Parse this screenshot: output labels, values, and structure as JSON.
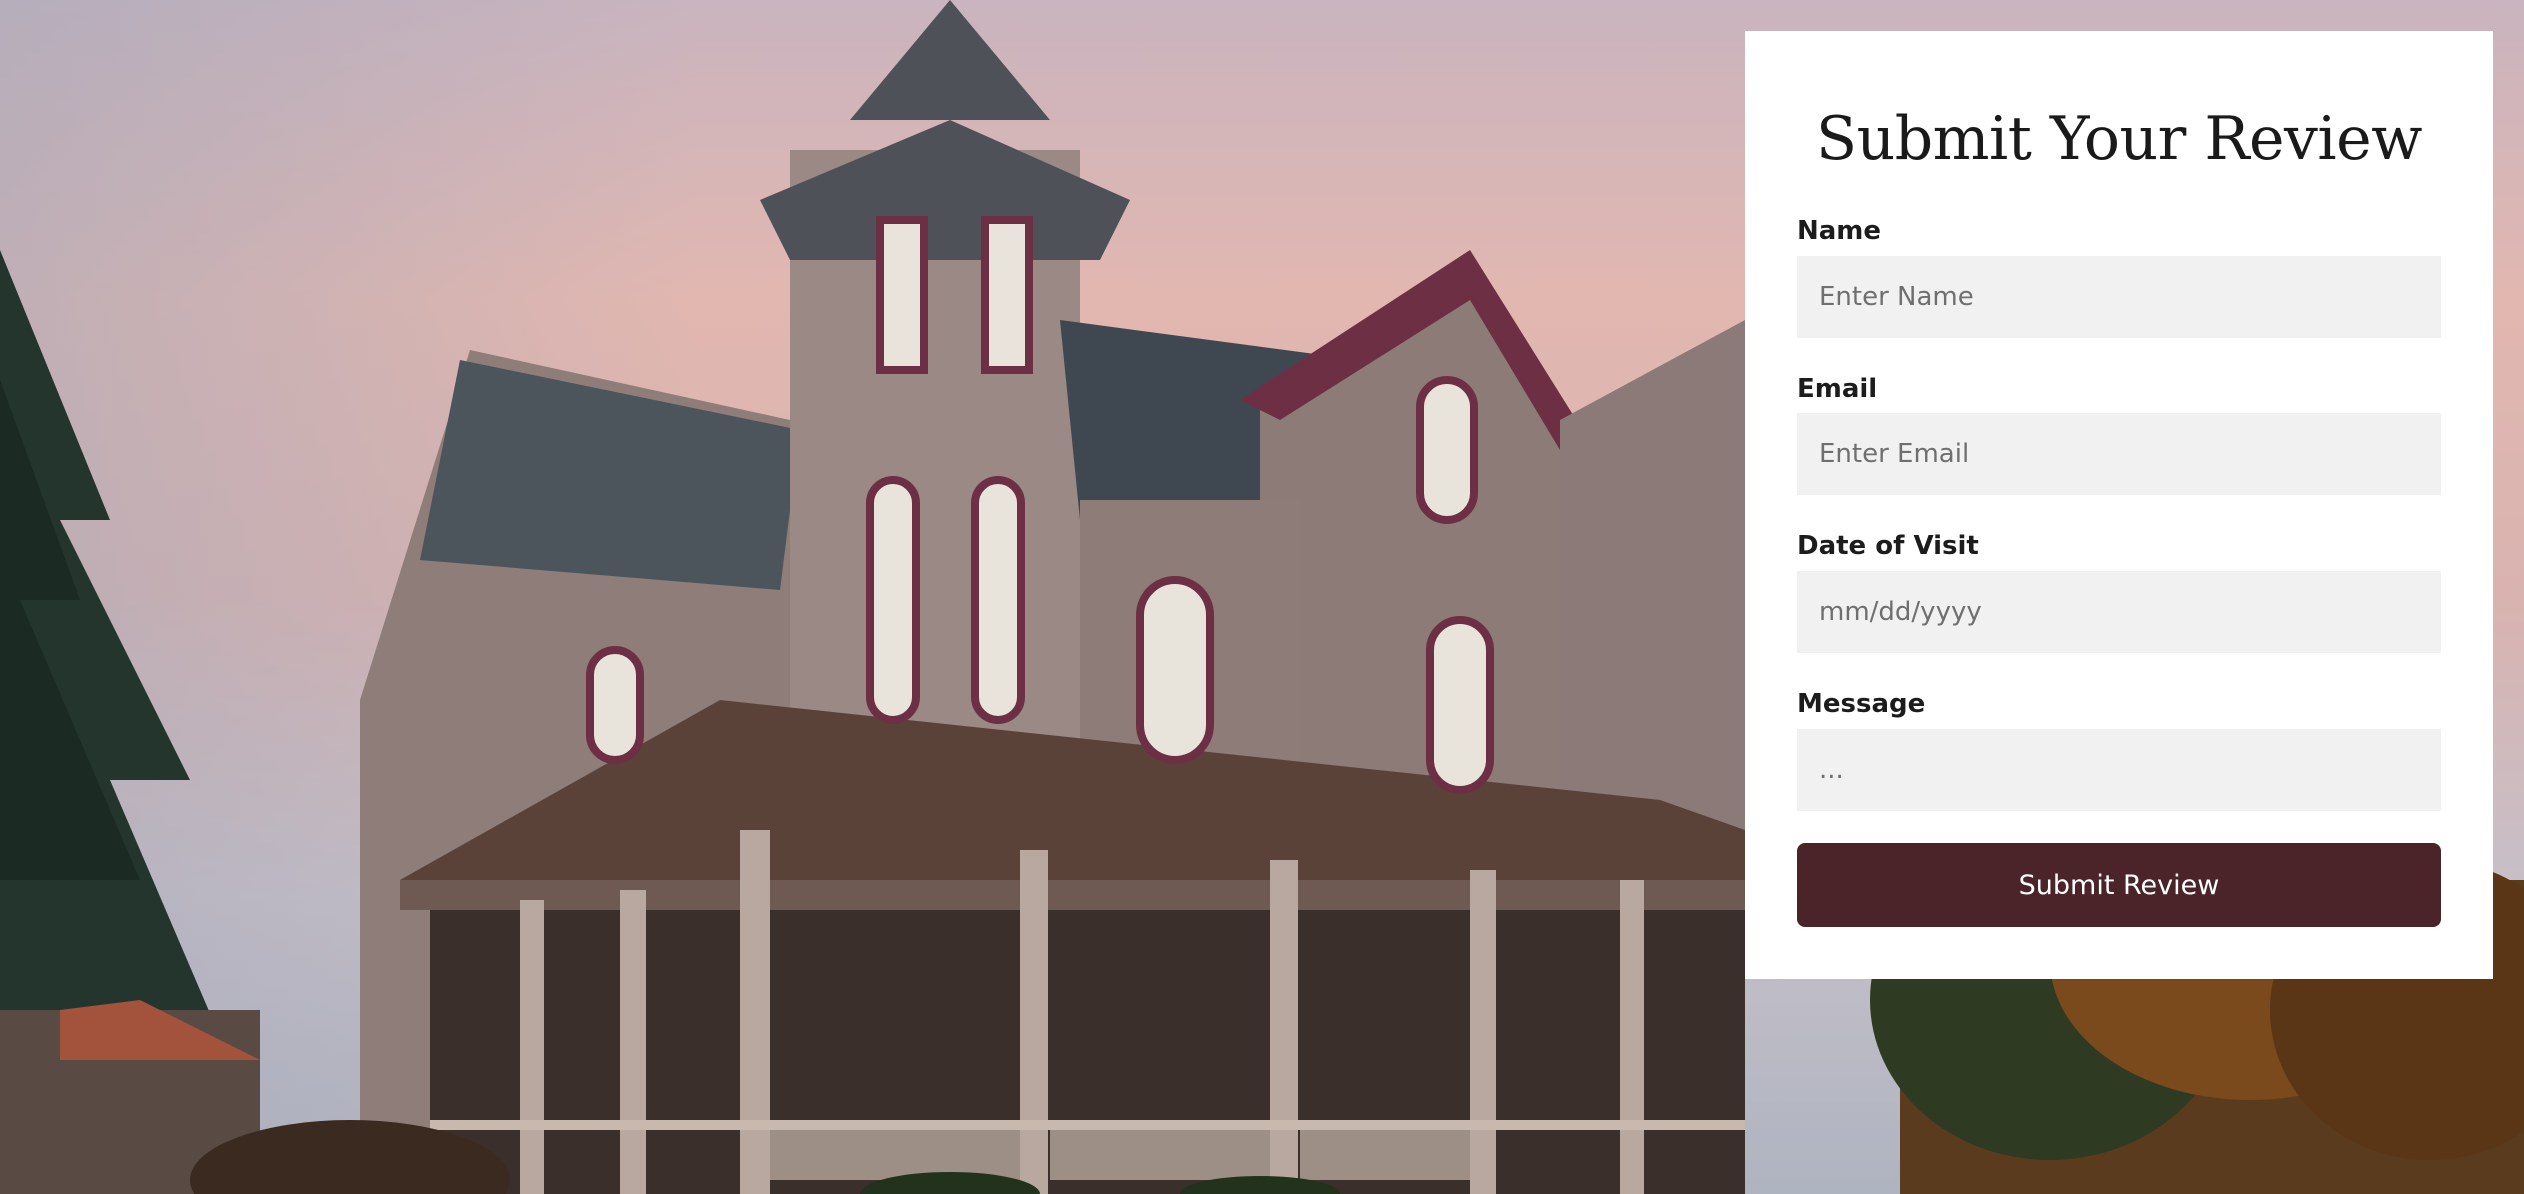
{
  "background": {
    "description_icon": "victorian-house-photo"
  },
  "form": {
    "title": "Submit Your Review",
    "name": {
      "label": "Name",
      "placeholder": "Enter Name"
    },
    "email": {
      "label": "Email",
      "placeholder": "Enter Email"
    },
    "date": {
      "label": "Date of Visit",
      "placeholder": "mm/dd/yyyy"
    },
    "message": {
      "label": "Message",
      "placeholder": "..."
    },
    "submit_label": "Submit Review"
  },
  "colors": {
    "button_bg": "#4a2428",
    "input_bg": "#f1f1f1",
    "card_bg": "#ffffff"
  }
}
